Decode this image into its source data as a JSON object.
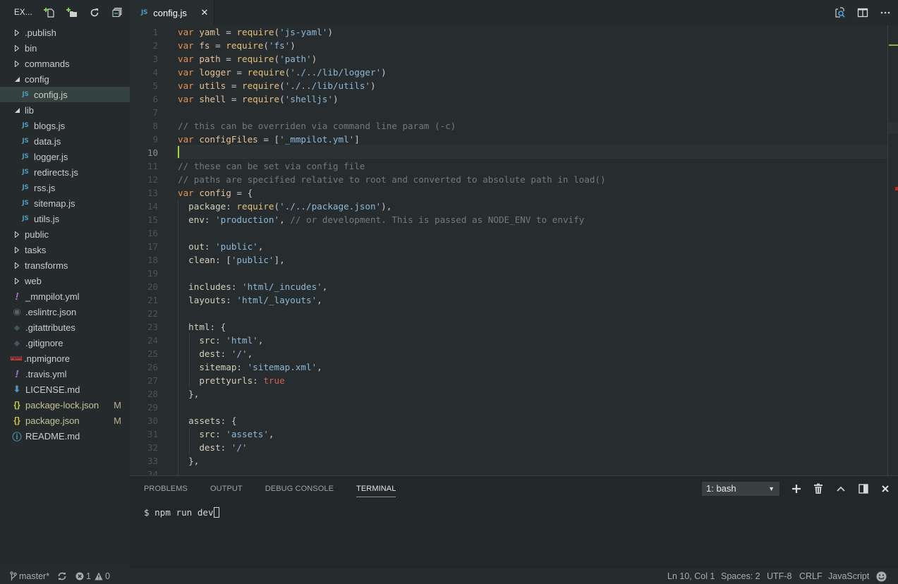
{
  "sidebar": {
    "title": "EX...",
    "actions": [
      {
        "name": "new-file-icon"
      },
      {
        "name": "new-folder-icon"
      },
      {
        "name": "refresh-icon"
      },
      {
        "name": "collapse-all-icon"
      }
    ],
    "tree": [
      {
        "label": ".publish",
        "type": "folder",
        "expanded": false,
        "depth": 0
      },
      {
        "label": "bin",
        "type": "folder",
        "expanded": false,
        "depth": 0
      },
      {
        "label": "commands",
        "type": "folder",
        "expanded": false,
        "depth": 0
      },
      {
        "label": "config",
        "type": "folder",
        "expanded": true,
        "depth": 0
      },
      {
        "label": "config.js",
        "type": "js",
        "depth": 1,
        "selected": true
      },
      {
        "label": "lib",
        "type": "folder",
        "expanded": true,
        "depth": 0
      },
      {
        "label": "blogs.js",
        "type": "js",
        "depth": 1
      },
      {
        "label": "data.js",
        "type": "js",
        "depth": 1
      },
      {
        "label": "logger.js",
        "type": "js",
        "depth": 1
      },
      {
        "label": "redirects.js",
        "type": "js",
        "depth": 1
      },
      {
        "label": "rss.js",
        "type": "js",
        "depth": 1
      },
      {
        "label": "sitemap.js",
        "type": "js",
        "depth": 1
      },
      {
        "label": "utils.js",
        "type": "js",
        "depth": 1
      },
      {
        "label": "public",
        "type": "folder",
        "expanded": false,
        "depth": 0
      },
      {
        "label": "tasks",
        "type": "folder",
        "expanded": false,
        "depth": 0
      },
      {
        "label": "transforms",
        "type": "folder",
        "expanded": false,
        "depth": 0
      },
      {
        "label": "web",
        "type": "folder",
        "expanded": false,
        "depth": 0
      },
      {
        "label": "_mmpilot.yml",
        "type": "yaml",
        "depth": 0
      },
      {
        "label": ".eslintrc.json",
        "type": "eslint",
        "depth": 0
      },
      {
        "label": ".gitattributes",
        "type": "git",
        "depth": 0
      },
      {
        "label": ".gitignore",
        "type": "git",
        "depth": 0
      },
      {
        "label": ".npmignore",
        "type": "npm",
        "depth": 0
      },
      {
        "label": ".travis.yml",
        "type": "yaml",
        "depth": 0
      },
      {
        "label": "LICENSE.md",
        "type": "license",
        "depth": 0
      },
      {
        "label": "package-lock.json",
        "type": "json",
        "depth": 0,
        "badge": "M"
      },
      {
        "label": "package.json",
        "type": "json",
        "depth": 0,
        "badge": "M"
      },
      {
        "label": "README.md",
        "type": "info",
        "depth": 0
      }
    ]
  },
  "tabs": [
    {
      "label": "config.js",
      "icon": "JS",
      "active": true
    }
  ],
  "editor": {
    "active_line": 10,
    "lines": [
      [
        [
          "kw",
          "var "
        ],
        [
          "var",
          "yaml"
        ],
        [
          "pun",
          " = "
        ],
        [
          "fn",
          "require"
        ],
        [
          "pun",
          "("
        ],
        [
          "str",
          "'js-yaml'"
        ],
        [
          "pun",
          ")"
        ]
      ],
      [
        [
          "kw",
          "var "
        ],
        [
          "var",
          "fs"
        ],
        [
          "pun",
          " = "
        ],
        [
          "fn",
          "require"
        ],
        [
          "pun",
          "("
        ],
        [
          "str",
          "'fs'"
        ],
        [
          "pun",
          ")"
        ]
      ],
      [
        [
          "kw",
          "var "
        ],
        [
          "var",
          "path"
        ],
        [
          "pun",
          " = "
        ],
        [
          "fn",
          "require"
        ],
        [
          "pun",
          "("
        ],
        [
          "str",
          "'path'"
        ],
        [
          "pun",
          ")"
        ]
      ],
      [
        [
          "kw",
          "var "
        ],
        [
          "var",
          "logger"
        ],
        [
          "pun",
          " = "
        ],
        [
          "fn",
          "require"
        ],
        [
          "pun",
          "("
        ],
        [
          "str",
          "'./../lib/logger'"
        ],
        [
          "pun",
          ")"
        ]
      ],
      [
        [
          "kw",
          "var "
        ],
        [
          "var",
          "utils"
        ],
        [
          "pun",
          " = "
        ],
        [
          "fn",
          "require"
        ],
        [
          "pun",
          "("
        ],
        [
          "str",
          "'./../lib/utils'"
        ],
        [
          "pun",
          ")"
        ]
      ],
      [
        [
          "kw",
          "var "
        ],
        [
          "var",
          "shell"
        ],
        [
          "pun",
          " = "
        ],
        [
          "fn",
          "require"
        ],
        [
          "pun",
          "("
        ],
        [
          "str",
          "'shelljs'"
        ],
        [
          "pun",
          ")"
        ]
      ],
      [],
      [
        [
          "cm",
          "// this can be overriden via command line param (-c)"
        ]
      ],
      [
        [
          "kw",
          "var "
        ],
        [
          "var",
          "configFiles"
        ],
        [
          "pun",
          " = ["
        ],
        [
          "str",
          "'_mmpilot.yml'"
        ],
        [
          "pun",
          "]"
        ]
      ],
      [],
      [
        [
          "cm",
          "// these can be set via config file"
        ]
      ],
      [
        [
          "cm",
          "// paths are specified relative to root and converted to absolute path in load()"
        ]
      ],
      [
        [
          "kw",
          "var "
        ],
        [
          "var",
          "config"
        ],
        [
          "pun",
          " = {"
        ]
      ],
      [
        [
          "prop",
          "  package"
        ],
        [
          "pun",
          ": "
        ],
        [
          "fn",
          "require"
        ],
        [
          "pun",
          "("
        ],
        [
          "str",
          "'./../package.json'"
        ],
        [
          "pun",
          "),"
        ]
      ],
      [
        [
          "prop",
          "  env"
        ],
        [
          "pun",
          ": "
        ],
        [
          "str",
          "'production'"
        ],
        [
          "pun",
          ", "
        ],
        [
          "cm",
          "// or development. This is passed as NODE_ENV to envify"
        ]
      ],
      [],
      [
        [
          "prop",
          "  out"
        ],
        [
          "pun",
          ": "
        ],
        [
          "str",
          "'public'"
        ],
        [
          "pun",
          ","
        ]
      ],
      [
        [
          "prop",
          "  clean"
        ],
        [
          "pun",
          ": ["
        ],
        [
          "str",
          "'public'"
        ],
        [
          "pun",
          "],"
        ]
      ],
      [],
      [
        [
          "prop",
          "  includes"
        ],
        [
          "pun",
          ": "
        ],
        [
          "str",
          "'html/_incudes'"
        ],
        [
          "pun",
          ","
        ]
      ],
      [
        [
          "prop",
          "  layouts"
        ],
        [
          "pun",
          ": "
        ],
        [
          "str",
          "'html/_layouts'"
        ],
        [
          "pun",
          ","
        ]
      ],
      [],
      [
        [
          "prop",
          "  html"
        ],
        [
          "pun",
          ": {"
        ]
      ],
      [
        [
          "prop",
          "    src"
        ],
        [
          "pun",
          ": "
        ],
        [
          "str",
          "'html'"
        ],
        [
          "pun",
          ","
        ]
      ],
      [
        [
          "prop",
          "    dest"
        ],
        [
          "pun",
          ": "
        ],
        [
          "str",
          "'/'"
        ],
        [
          "pun",
          ","
        ]
      ],
      [
        [
          "prop",
          "    sitemap"
        ],
        [
          "pun",
          ": "
        ],
        [
          "str",
          "'sitemap.xml'"
        ],
        [
          "pun",
          ","
        ]
      ],
      [
        [
          "prop",
          "    prettyurls"
        ],
        [
          "pun",
          ": "
        ],
        [
          "bool",
          "true"
        ]
      ],
      [
        [
          "pun",
          "  },"
        ]
      ],
      [],
      [
        [
          "prop",
          "  assets"
        ],
        [
          "pun",
          ": {"
        ]
      ],
      [
        [
          "prop",
          "    src"
        ],
        [
          "pun",
          ": "
        ],
        [
          "str",
          "'assets'"
        ],
        [
          "pun",
          ","
        ]
      ],
      [
        [
          "prop",
          "    dest"
        ],
        [
          "pun",
          ": "
        ],
        [
          "str",
          "'/'"
        ]
      ],
      [
        [
          "pun",
          "  },"
        ]
      ],
      []
    ]
  },
  "panel": {
    "tabs": [
      "PROBLEMS",
      "OUTPUT",
      "DEBUG CONSOLE",
      "TERMINAL"
    ],
    "active_tab": "TERMINAL",
    "terminal_select": "1: bash",
    "terminal_text": "$ npm run dev"
  },
  "status": {
    "branch": "master*",
    "errors": "1",
    "warnings": "0",
    "position": "Ln 10, Col 1",
    "spaces": "Spaces: 2",
    "encoding": "UTF-8",
    "eol": "CRLF",
    "language": "JavaScript"
  },
  "colors": {
    "accent_cursor": "#a6d63a",
    "error_marker": "#cc2222",
    "js_icon": "#519aba",
    "modified_badge": "#b5b28b"
  }
}
